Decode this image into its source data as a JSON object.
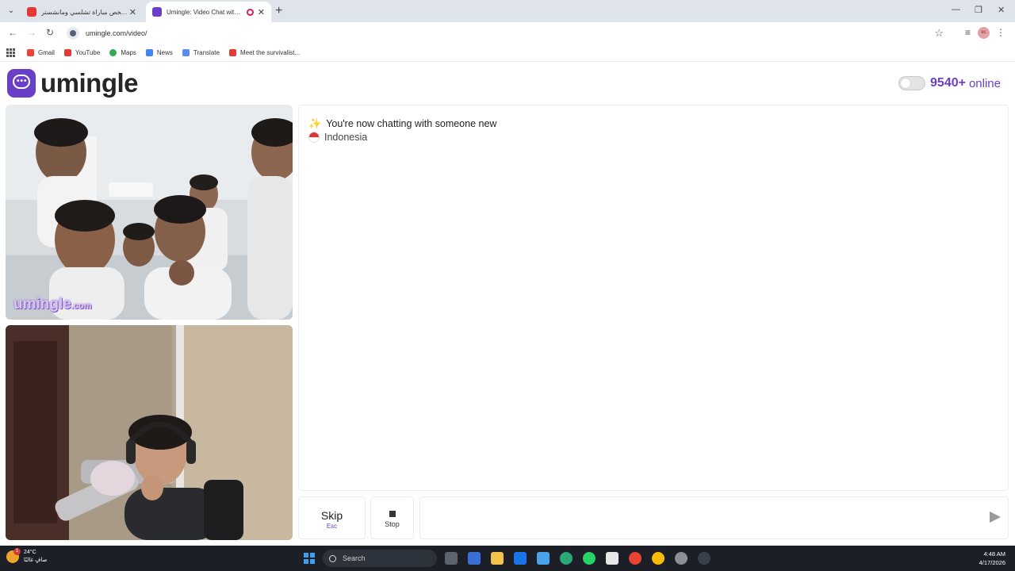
{
  "browser": {
    "tabs": [
      {
        "title": "ملخص مباراة تشلسي ومانشستر ...",
        "active": false
      },
      {
        "title": "Umingle: Video Chat with Strangers",
        "active": true
      }
    ],
    "url": "umingle.com/video/",
    "bookmarks": [
      "Gmail",
      "YouTube",
      "Maps",
      "News",
      "Translate",
      "Meet the survivalist..."
    ],
    "profile_initials": "ec"
  },
  "site": {
    "logo_text": "umingle",
    "online_count": "9540+",
    "online_label": "online",
    "watermark": "umingle",
    "watermark_suffix": ".com"
  },
  "chat": {
    "status_message": "You're now chatting with someone new",
    "country": "Indonesia"
  },
  "controls": {
    "skip_label": "Skip",
    "skip_hint": "Esc",
    "stop_label": "Stop",
    "message_placeholder": ""
  },
  "taskbar": {
    "temperature": "24°C",
    "weather_desc": "صافٍ غالبًا",
    "search_label": "Search",
    "time": "4:48 AM",
    "date": "4/17/2026",
    "notification_count": "1"
  },
  "colors": {
    "brand": "#6a3fc8",
    "taskbar": "#1c1f26"
  }
}
